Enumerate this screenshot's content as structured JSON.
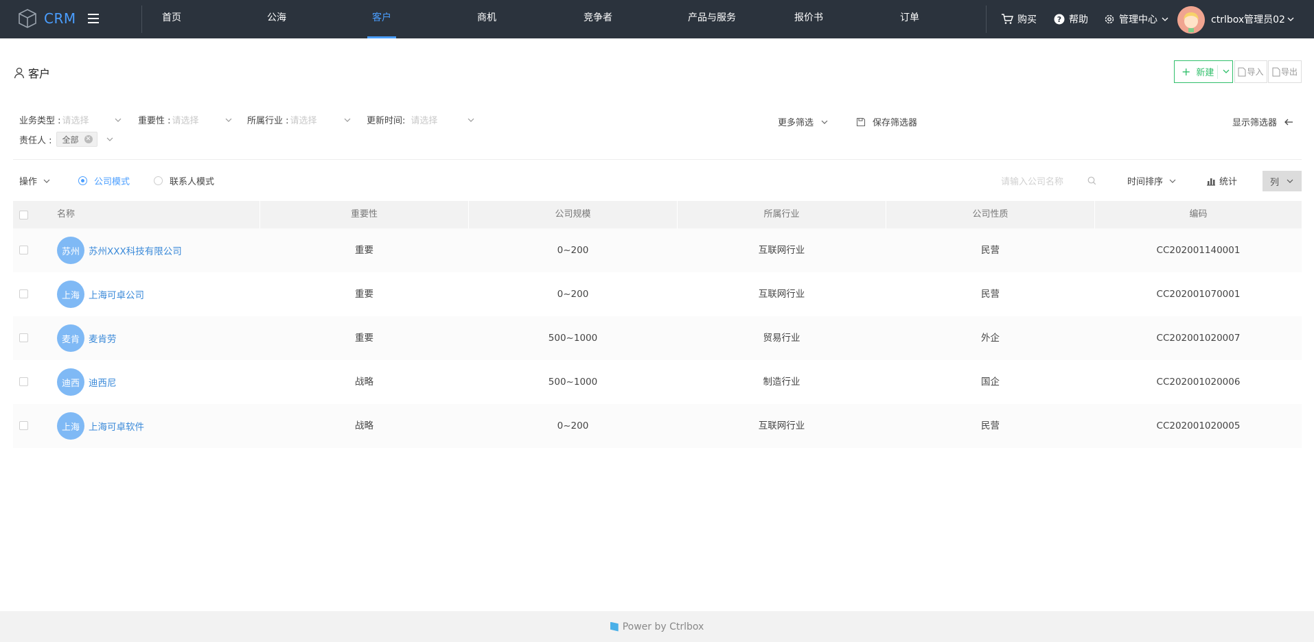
{
  "app": {
    "logo_text": "CRM"
  },
  "nav": {
    "items": [
      {
        "label": "首页"
      },
      {
        "label": "公海"
      },
      {
        "label": "客户"
      },
      {
        "label": "商机"
      },
      {
        "label": "竞争者"
      },
      {
        "label": "产品与服务"
      },
      {
        "label": "报价书"
      },
      {
        "label": "订单"
      }
    ],
    "active": "客户",
    "right": {
      "buy": "购买",
      "help": "帮助",
      "admin": "管理中心",
      "user": "ctrlbox管理员02"
    }
  },
  "page": {
    "title": "客户",
    "new_label": "新建",
    "import_label": "导入",
    "export_label": "导出"
  },
  "filters": {
    "business_type": {
      "label": "业务类型 :",
      "placeholder": "请选择"
    },
    "importance": {
      "label": "重要性 :",
      "placeholder": "请选择"
    },
    "industry": {
      "label": "所属行业 :",
      "placeholder": "请选择"
    },
    "updated_time": {
      "label": "更新时间:",
      "placeholder": "请选择"
    },
    "owner": {
      "label": "责任人 :",
      "tag": "全部"
    },
    "more": "更多筛选",
    "save": "保存筛选器",
    "show": "显示筛选器"
  },
  "toolbar": {
    "operate": "操作",
    "mode_company": "公司模式",
    "mode_contact": "联系人模式",
    "search_placeholder": "请输入公司名称",
    "sort": "时间排序",
    "stats": "统计",
    "columns": "列"
  },
  "table": {
    "headers": [
      "名称",
      "重要性",
      "公司规模",
      "所属行业",
      "公司性质",
      "编码"
    ],
    "rows": [
      {
        "avatar": "苏州",
        "name": "苏州XXX科技有限公司",
        "importance": "重要",
        "scale": "0~200",
        "industry": "互联网行业",
        "nature": "民营",
        "code": "CC202001140001"
      },
      {
        "avatar": "上海",
        "name": "上海可卓公司",
        "importance": "重要",
        "scale": "0~200",
        "industry": "互联网行业",
        "nature": "民营",
        "code": "CC202001070001"
      },
      {
        "avatar": "麦肯",
        "name": "麦肯劳",
        "importance": "重要",
        "scale": "500~1000",
        "industry": "贸易行业",
        "nature": "外企",
        "code": "CC202001020007"
      },
      {
        "avatar": "迪西",
        "name": "迪西尼",
        "importance": "战略",
        "scale": "500~1000",
        "industry": "制造行业",
        "nature": "国企",
        "code": "CC202001020006"
      },
      {
        "avatar": "上海",
        "name": "上海可卓软件",
        "importance": "战略",
        "scale": "0~200",
        "industry": "互联网行业",
        "nature": "民营",
        "code": "CC202001020005"
      }
    ]
  },
  "footer": {
    "text": "Power by Ctrlbox"
  },
  "colors": {
    "accent": "#4a9eff",
    "topbar": "#2b333d",
    "new_button": "#2fbf6a",
    "avatar": "#7fb9f5"
  }
}
